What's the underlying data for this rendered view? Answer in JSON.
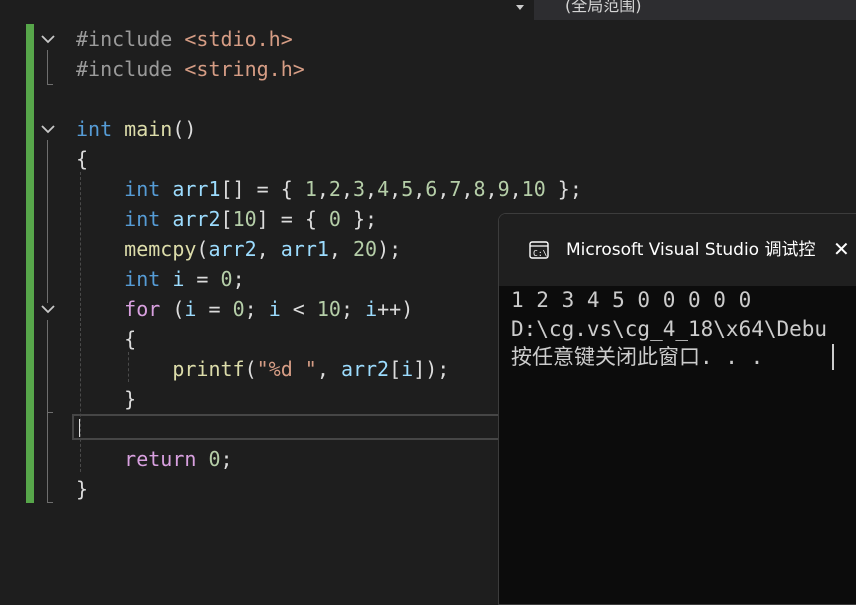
{
  "nav": {
    "scope_dropdown_icon": "chevron-down-icon",
    "scope_label": "(全局范围)"
  },
  "editor": {
    "lines": [
      [
        {
          "c": "pp",
          "t": "#include "
        },
        {
          "c": "hdr",
          "t": "<stdio.h>"
        }
      ],
      [
        {
          "c": "pp",
          "t": "#include "
        },
        {
          "c": "hdr",
          "t": "<string.h>"
        }
      ],
      [],
      [
        {
          "c": "kw",
          "t": "int"
        },
        {
          "c": "plain",
          "t": " "
        },
        {
          "c": "fn",
          "t": "main"
        },
        {
          "c": "plain",
          "t": "()"
        }
      ],
      [
        {
          "c": "plain",
          "t": "{"
        }
      ],
      [
        {
          "c": "plain",
          "t": "    "
        },
        {
          "c": "kw",
          "t": "int"
        },
        {
          "c": "plain",
          "t": " "
        },
        {
          "c": "var",
          "t": "arr1"
        },
        {
          "c": "plain",
          "t": "[] = { "
        },
        {
          "c": "num",
          "t": "1"
        },
        {
          "c": "plain",
          "t": ","
        },
        {
          "c": "num",
          "t": "2"
        },
        {
          "c": "plain",
          "t": ","
        },
        {
          "c": "num",
          "t": "3"
        },
        {
          "c": "plain",
          "t": ","
        },
        {
          "c": "num",
          "t": "4"
        },
        {
          "c": "plain",
          "t": ","
        },
        {
          "c": "num",
          "t": "5"
        },
        {
          "c": "plain",
          "t": ","
        },
        {
          "c": "num",
          "t": "6"
        },
        {
          "c": "plain",
          "t": ","
        },
        {
          "c": "num",
          "t": "7"
        },
        {
          "c": "plain",
          "t": ","
        },
        {
          "c": "num",
          "t": "8"
        },
        {
          "c": "plain",
          "t": ","
        },
        {
          "c": "num",
          "t": "9"
        },
        {
          "c": "plain",
          "t": ","
        },
        {
          "c": "num",
          "t": "10"
        },
        {
          "c": "plain",
          "t": " };"
        }
      ],
      [
        {
          "c": "plain",
          "t": "    "
        },
        {
          "c": "kw",
          "t": "int"
        },
        {
          "c": "plain",
          "t": " "
        },
        {
          "c": "var",
          "t": "arr2"
        },
        {
          "c": "plain",
          "t": "["
        },
        {
          "c": "num",
          "t": "10"
        },
        {
          "c": "plain",
          "t": "] = { "
        },
        {
          "c": "num",
          "t": "0"
        },
        {
          "c": "plain",
          "t": " };"
        }
      ],
      [
        {
          "c": "plain",
          "t": "    "
        },
        {
          "c": "fn",
          "t": "memcpy"
        },
        {
          "c": "plain",
          "t": "("
        },
        {
          "c": "var",
          "t": "arr2"
        },
        {
          "c": "plain",
          "t": ", "
        },
        {
          "c": "var",
          "t": "arr1"
        },
        {
          "c": "plain",
          "t": ", "
        },
        {
          "c": "num",
          "t": "20"
        },
        {
          "c": "plain",
          "t": ");"
        }
      ],
      [
        {
          "c": "plain",
          "t": "    "
        },
        {
          "c": "kw",
          "t": "int"
        },
        {
          "c": "plain",
          "t": " "
        },
        {
          "c": "var",
          "t": "i"
        },
        {
          "c": "plain",
          "t": " = "
        },
        {
          "c": "num",
          "t": "0"
        },
        {
          "c": "plain",
          "t": ";"
        }
      ],
      [
        {
          "c": "plain",
          "t": "    "
        },
        {
          "c": "ctl",
          "t": "for"
        },
        {
          "c": "plain",
          "t": " ("
        },
        {
          "c": "var",
          "t": "i"
        },
        {
          "c": "plain",
          "t": " = "
        },
        {
          "c": "num",
          "t": "0"
        },
        {
          "c": "plain",
          "t": "; "
        },
        {
          "c": "var",
          "t": "i"
        },
        {
          "c": "plain",
          "t": " < "
        },
        {
          "c": "num",
          "t": "10"
        },
        {
          "c": "plain",
          "t": "; "
        },
        {
          "c": "var",
          "t": "i"
        },
        {
          "c": "plain",
          "t": "++)"
        }
      ],
      [
        {
          "c": "plain",
          "t": "    {"
        }
      ],
      [
        {
          "c": "plain",
          "t": "        "
        },
        {
          "c": "fn",
          "t": "printf"
        },
        {
          "c": "plain",
          "t": "("
        },
        {
          "c": "str",
          "t": "\"%d \""
        },
        {
          "c": "plain",
          "t": ", "
        },
        {
          "c": "var",
          "t": "arr2"
        },
        {
          "c": "plain",
          "t": "["
        },
        {
          "c": "var",
          "t": "i"
        },
        {
          "c": "plain",
          "t": "]);"
        }
      ],
      [
        {
          "c": "plain",
          "t": "    }"
        }
      ],
      [],
      [
        {
          "c": "plain",
          "t": "    "
        },
        {
          "c": "ctl",
          "t": "return"
        },
        {
          "c": "plain",
          "t": " "
        },
        {
          "c": "num",
          "t": "0"
        },
        {
          "c": "plain",
          "t": ";"
        }
      ],
      [
        {
          "c": "plain",
          "t": "}"
        }
      ]
    ]
  },
  "console": {
    "icon": "console-icon",
    "title": "Microsoft Visual Studio 调试控",
    "close_icon": "close-icon",
    "close_glyph": "✕",
    "output": [
      "1 2 3 4 5 0 0 0 0 0",
      "D:\\cg.vs\\cg_4_18\\x64\\Debu",
      "按任意键关闭此窗口. . ."
    ]
  }
}
